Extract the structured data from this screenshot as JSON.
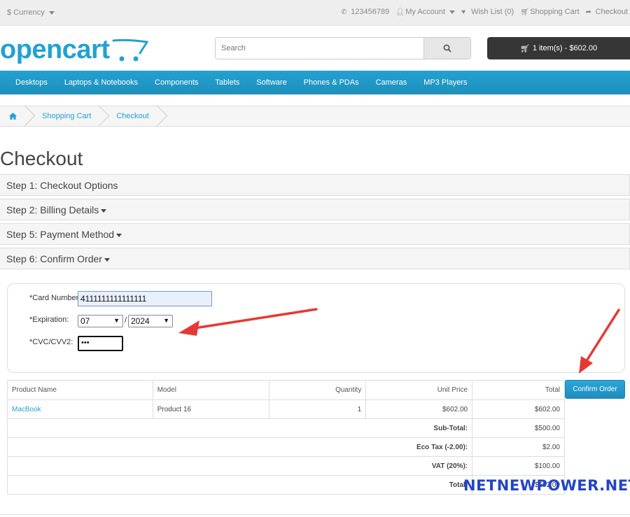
{
  "topbar": {
    "currency": "$ Currency",
    "phone": "123456789",
    "account": "My Account",
    "wishlist": "Wish List (0)",
    "cart": "Shopping Cart",
    "checkout": "Checkout"
  },
  "header": {
    "logo": "opencart",
    "search_placeholder": "Search",
    "cart_button": "1 item(s) - $602.00"
  },
  "nav": [
    "Desktops",
    "Laptops & Notebooks",
    "Components",
    "Tablets",
    "Software",
    "Phones & PDAs",
    "Cameras",
    "MP3 Players"
  ],
  "breadcrumb": [
    "Shopping Cart",
    "Checkout"
  ],
  "page_title": "Checkout",
  "steps": [
    {
      "label": "Step 1: Checkout Options"
    },
    {
      "label": "Step 2: Billing Details"
    },
    {
      "label": "Step 5: Payment Method"
    },
    {
      "label": "Step 6: Confirm Order"
    }
  ],
  "payment": {
    "card_label": "*Card Number:",
    "card_value": "4111111111111111",
    "expiration_label": "*Expiration:",
    "month": "07",
    "slash": "/",
    "year": "2024",
    "cvc_label": "*CVC/CVV2:",
    "cvc_value": "•••"
  },
  "table": {
    "headers": [
      "Product Name",
      "Model",
      "Quantity",
      "Unit Price",
      "Total"
    ],
    "row": {
      "name": "MacBook",
      "model": "Product 16",
      "qty": "1",
      "price": "$602.00",
      "total": "$602.00"
    },
    "totals": [
      {
        "label": "Sub-Total:",
        "value": "$500.00"
      },
      {
        "label": "Eco Tax (-2.00):",
        "value": "$2.00"
      },
      {
        "label": "VAT (20%):",
        "value": "$100.00"
      },
      {
        "label": "Total:",
        "value": "$602.00"
      }
    ]
  },
  "confirm_button": "Confirm Order",
  "watermark": "NETNEWPOWER.NET",
  "colors": {
    "accent": "#23a1d1",
    "arrow": "#e53935"
  }
}
